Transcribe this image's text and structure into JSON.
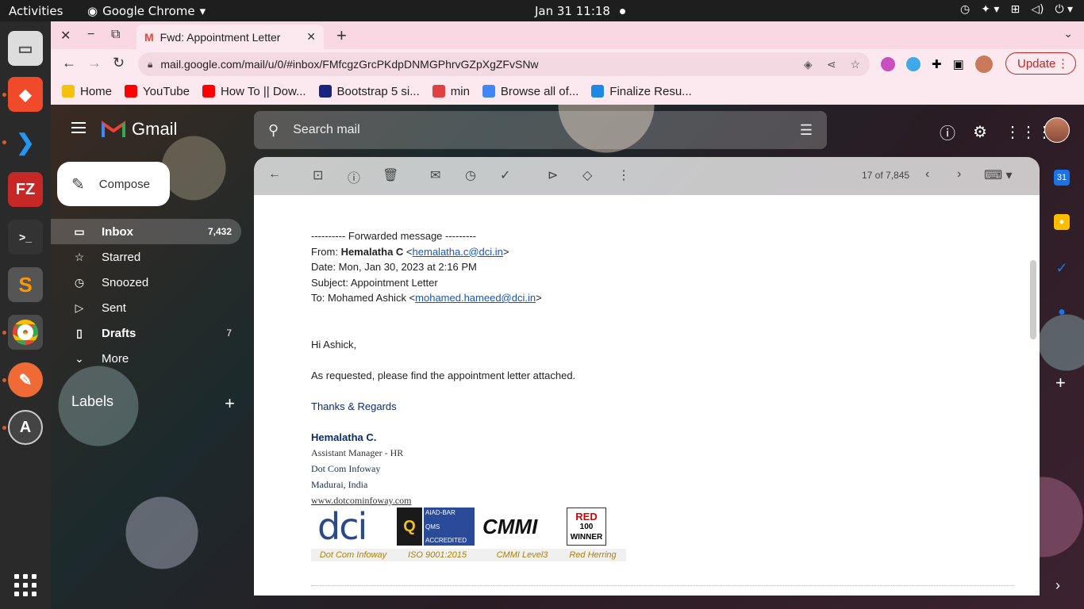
{
  "topbar": {
    "activities": "Activities",
    "app_name": "Google Chrome",
    "clock": "Jan 31  11:18"
  },
  "chrome": {
    "tab_title": "Fwd: Appointment Letter",
    "url": "mail.google.com/mail/u/0/#inbox/FMfcgzGrcPKdpDNMGPhrvGZpXgZFvSNw",
    "update_label": "Update",
    "bookmarks": [
      {
        "label": "Home",
        "color": "#f4c20d"
      },
      {
        "label": "YouTube",
        "color": "#ff0000"
      },
      {
        "label": "How To || Dow...",
        "color": "#ff0000"
      },
      {
        "label": "Bootstrap 5 si...",
        "color": "#1a237e"
      },
      {
        "label": "min",
        "color": "#e04040"
      },
      {
        "label": "Browse all of...",
        "color": "#4285f4"
      },
      {
        "label": "Finalize Resu...",
        "color": "#1e88e5"
      }
    ]
  },
  "gmail": {
    "product": "Gmail",
    "search_placeholder": "Search mail",
    "compose_label": "Compose",
    "nav": [
      {
        "label": "Inbox",
        "count": "7,432"
      },
      {
        "label": "Starred",
        "count": ""
      },
      {
        "label": "Snoozed",
        "count": ""
      },
      {
        "label": "Sent",
        "count": ""
      },
      {
        "label": "Drafts",
        "count": "7"
      },
      {
        "label": "More",
        "count": ""
      }
    ],
    "labels_heading": "Labels",
    "pager": "17 of 7,845"
  },
  "email": {
    "fwd_header": "---------- Forwarded message ---------",
    "from_label": "From: ",
    "from_name": "Hemalatha C",
    "from_email": "hemalatha.c@dci.in",
    "date": "Date: Mon, Jan 30, 2023 at 2:16 PM",
    "subject": "Subject: Appointment Letter",
    "to_label": "To: Mohamed Ashick <",
    "to_email": "mohamed.hameed@dci.in",
    "greeting": "Hi Ashick,",
    "body": "As requested, please find the appointment letter attached.",
    "closing": "Thanks & Regards",
    "sig_name": "Hemalatha C.",
    "sig_title": "Assistant Manager - HR",
    "sig_company": "Dot Com Infoway",
    "sig_location": "Madurai, India",
    "sig_web": "www.dotcominfoway.com",
    "logo_captions": [
      "Dot Com Infoway",
      "ISO 9001:2015",
      "CMMI Level3",
      "Red Herring"
    ],
    "logo_text": {
      "dci": "dci",
      "iso_top": "AIAD-BAR",
      "iso_mid": "QMS",
      "iso_bottom": "ACCREDITED",
      "cmmi": "CMMI",
      "red1": "RED",
      "red2": "100",
      "red3": "WINNER"
    }
  }
}
